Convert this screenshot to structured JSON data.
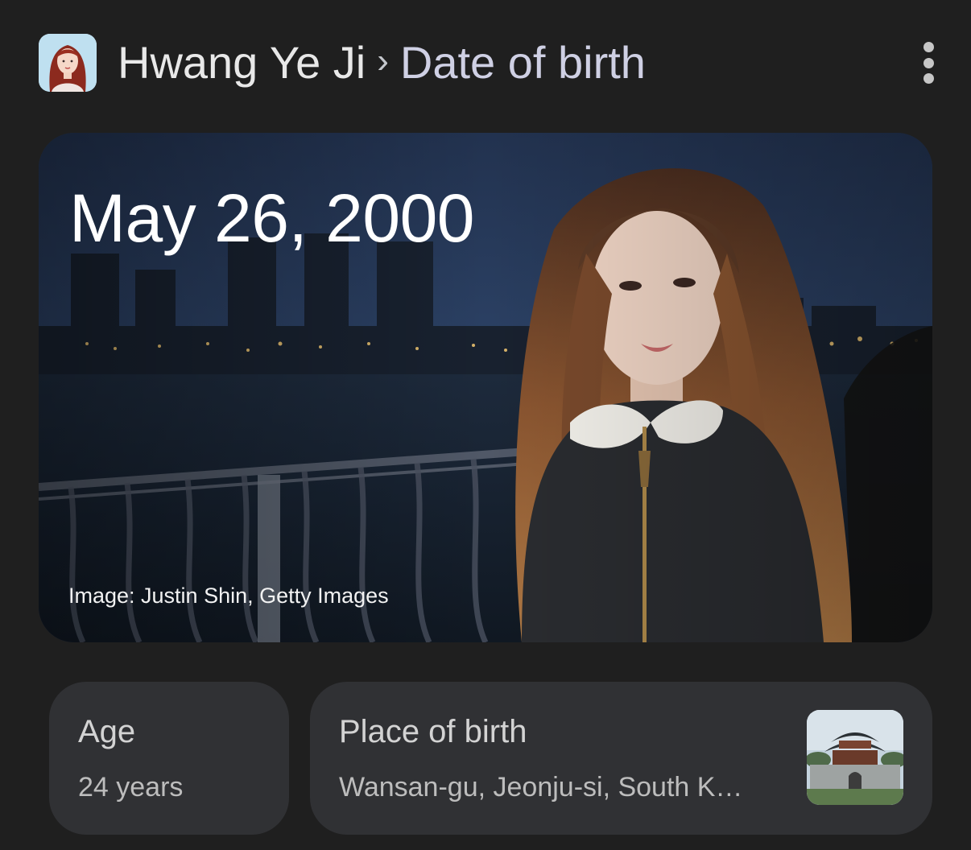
{
  "header": {
    "entity_name": "Hwang Ye Ji",
    "separator": "›",
    "current_section": "Date of birth",
    "avatar_icon": "person-avatar-icon",
    "more_icon": "more-vert-icon"
  },
  "hero": {
    "date": "May 26, 2000",
    "image_credit": "Image: Justin Shin, Getty Images"
  },
  "cards": {
    "age": {
      "label": "Age",
      "value": "24 years"
    },
    "place_of_birth": {
      "label": "Place of birth",
      "value": "Wansan-gu, Jeonju-si, South K…",
      "thumbnail_icon": "landmark-thumbnail"
    }
  },
  "colors": {
    "background": "#1f1f1f",
    "card_background": "#303134",
    "primary_text": "#e8e8e8",
    "secondary_text": "#bdbdbd",
    "breadcrumb_current": "#cfd0e4"
  }
}
